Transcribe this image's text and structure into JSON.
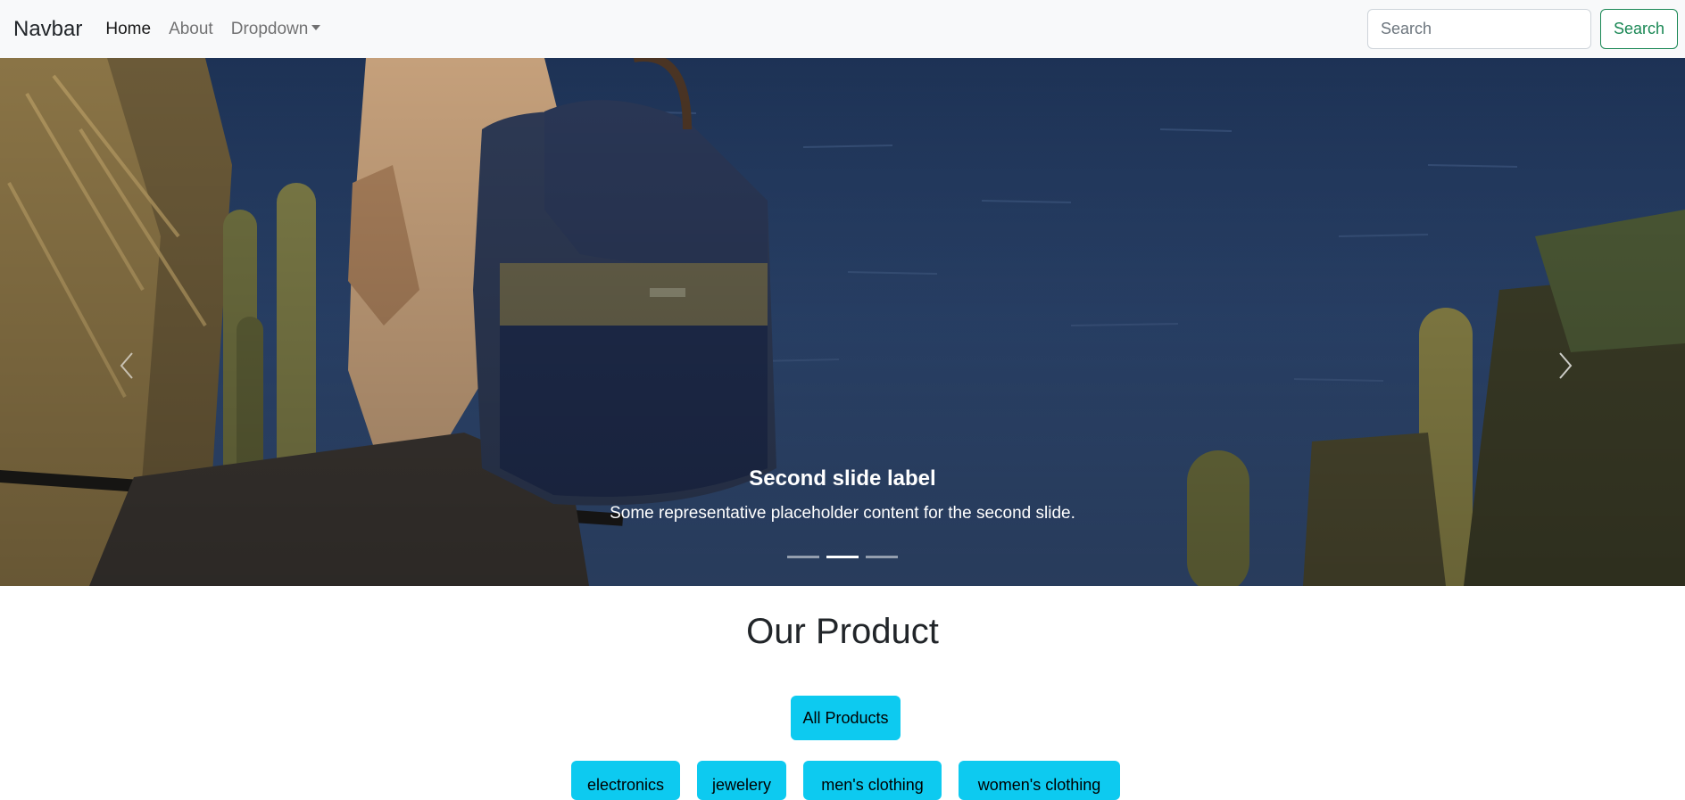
{
  "navbar": {
    "brand": "Navbar",
    "links": [
      "Home",
      "About",
      "Dropdown"
    ],
    "search_placeholder": "Search",
    "search_button": "Search"
  },
  "carousel": {
    "active_index": 1,
    "slide_count": 3,
    "caption_title": "Second slide label",
    "caption_text": "Some representative placeholder content for the second slide."
  },
  "products": {
    "title": "Our Product",
    "all_button": "All Products",
    "categories": [
      "electronics",
      "jewelery",
      "men's clothing",
      "women's clothing"
    ]
  },
  "colors": {
    "accent": "#0dcaf0",
    "success": "#198754",
    "navbar_bg": "#f8f9fa"
  }
}
